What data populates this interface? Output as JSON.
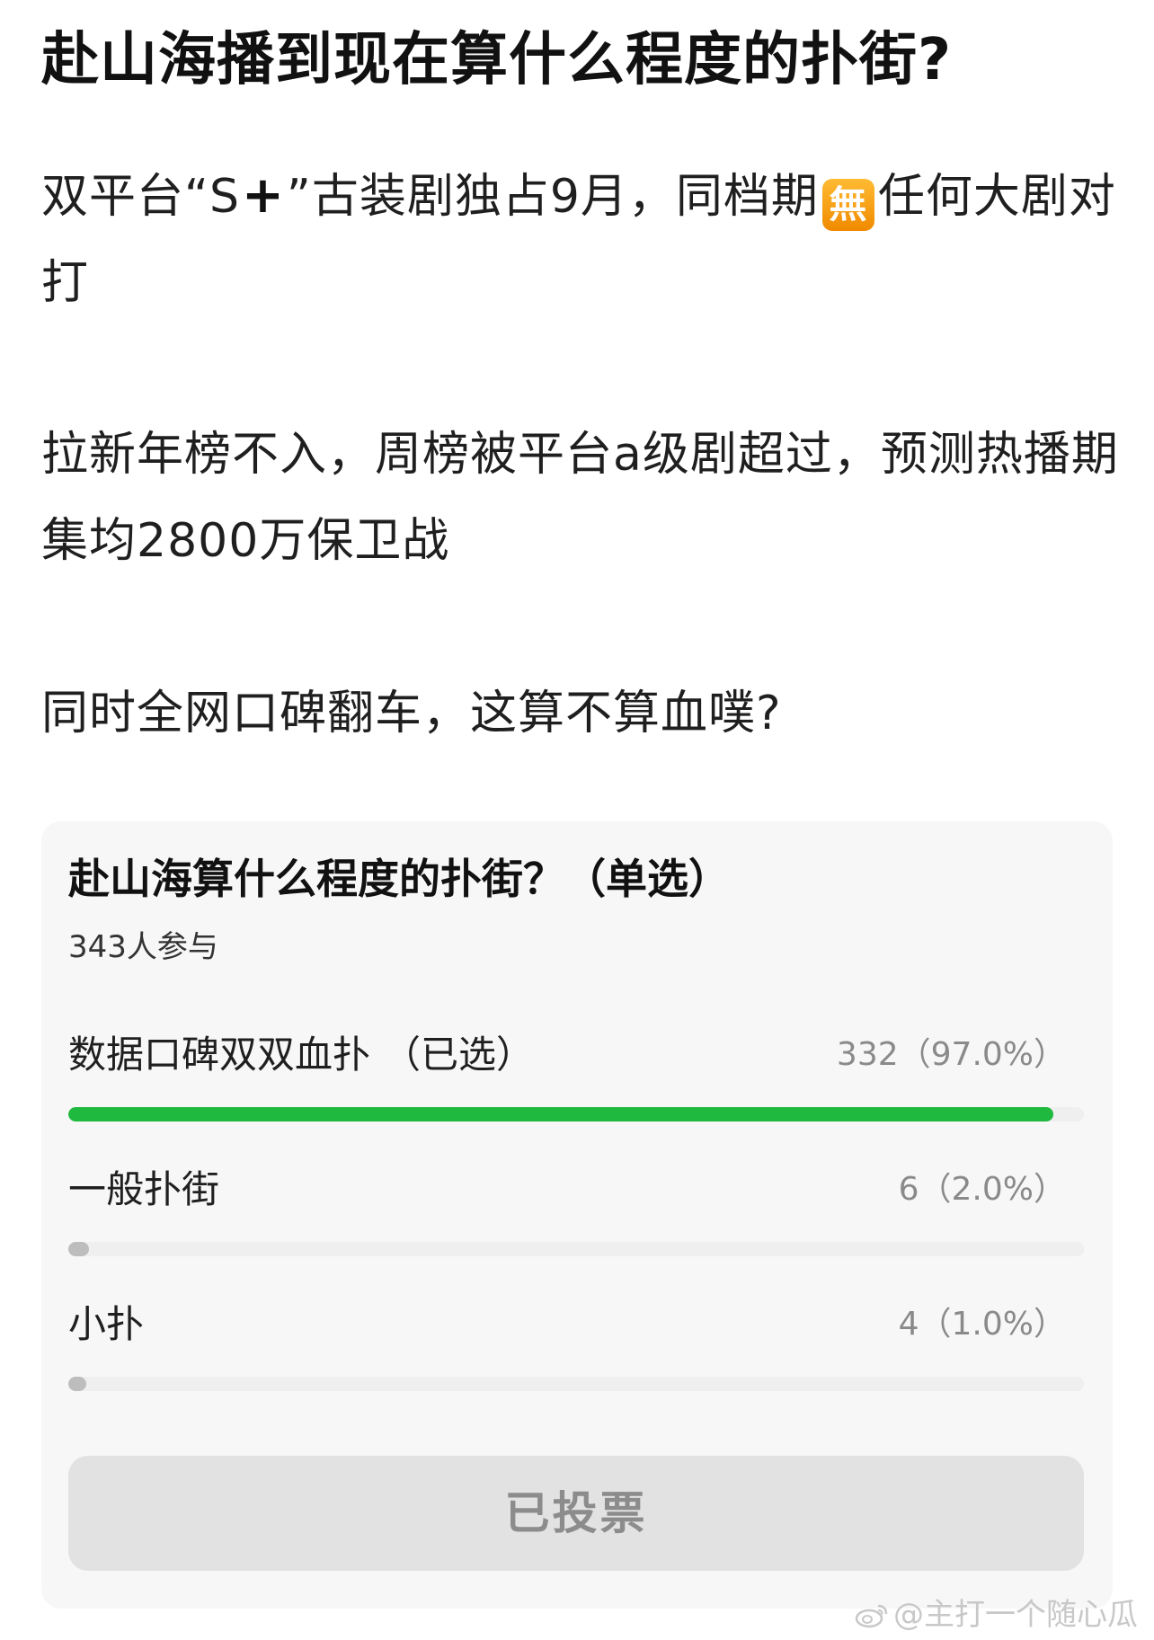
{
  "post": {
    "title": "赴山海播到现在算什么程度的扑街?",
    "para1_a": "双平台“S",
    "para1_plus": "+",
    "para1_b": "”古装剧独占9月，同档期",
    "para1_badge": "無",
    "para1_c": "任何大剧对打",
    "para2": "拉新年榜不入，周榜被平台a级剧超过，预测热播期集均2800万保卫战",
    "para3": "同时全网口碑翻车，这算不算血噗?"
  },
  "poll": {
    "title": "赴山海算什么程度的扑街？（单选）",
    "participants": "343人参与",
    "options": [
      {
        "label": "数据口碑双双血扑",
        "selected_suffix": "（已选）",
        "stat": "332（97.0%）",
        "fraction": 0.97,
        "selected": true
      },
      {
        "label": "一般扑街",
        "stat": "6（2.0%）",
        "fraction": 0.02,
        "selected": false
      },
      {
        "label": "小扑",
        "stat": "4（1.0%）",
        "fraction": 0.01,
        "selected": false
      }
    ],
    "vote_button_label": "已投票"
  },
  "watermark": {
    "text": "@主打一个随心瓜",
    "logo": "weibo-logo-icon"
  },
  "colors": {
    "selected_bar": "#1fb93f",
    "unselected_bar": "#bdbdbd",
    "badge": "#f5a000"
  }
}
